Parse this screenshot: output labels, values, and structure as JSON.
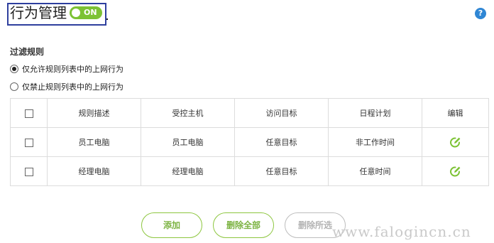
{
  "header": {
    "title": "行为管理",
    "toggle": {
      "label": "ON",
      "state": "on",
      "color": "#7cc234"
    },
    "help_icon": "question-circle-icon",
    "help_text": "?"
  },
  "filter": {
    "section_title": "过滤规则",
    "options": [
      {
        "label": "仅允许规则列表中的上网行为",
        "selected": true
      },
      {
        "label": "仅禁止规则列表中的上网行为",
        "selected": false
      }
    ]
  },
  "table": {
    "headers": [
      "规则描述",
      "受控主机",
      "访问目标",
      "日程计划",
      "编辑"
    ],
    "rows": [
      {
        "description": "员工电脑",
        "host": "员工电脑",
        "target": "任意目标",
        "schedule": "非工作时间",
        "edit_icon": "edit-icon"
      },
      {
        "description": "经理电脑",
        "host": "经理电脑",
        "target": "任意目标",
        "schedule": "任意时间",
        "edit_icon": "edit-icon"
      }
    ]
  },
  "buttons": {
    "add": "添加",
    "delete_all": "删除全部",
    "delete_selected": "删除所选"
  },
  "watermark": "www.falogincn.cn",
  "colors": {
    "accent": "#7cc234",
    "title_border": "#2e3f9e",
    "help": "#2f86d4",
    "disabled": "#b3b3b3"
  }
}
